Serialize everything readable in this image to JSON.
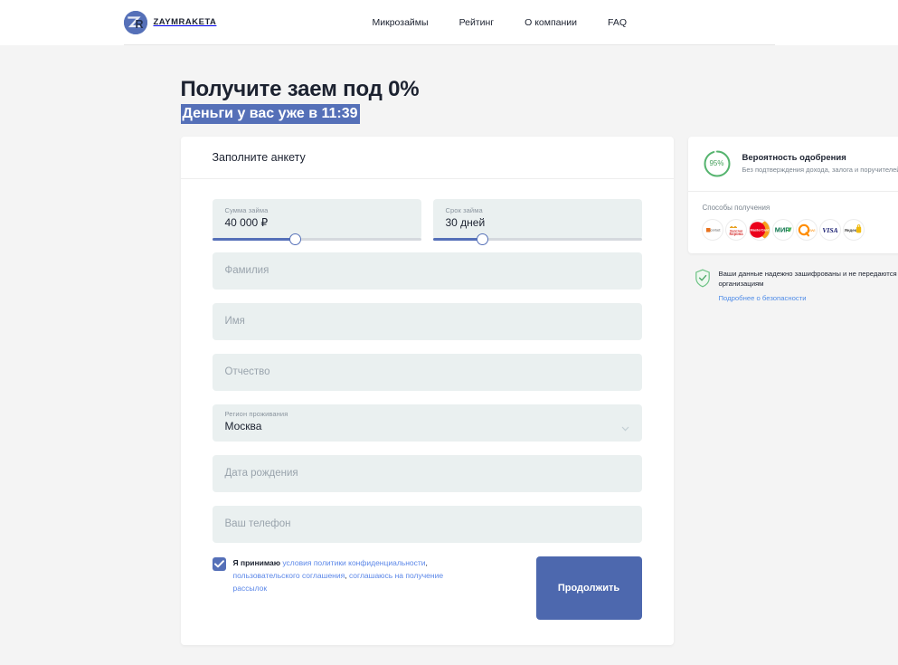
{
  "header": {
    "brand_name": "ZAYMRAKETA",
    "brand_mark_icon": "zr-monogram-logo-icon",
    "nav": [
      {
        "label": "Микрозаймы"
      },
      {
        "label": "Рейтинг"
      },
      {
        "label": "О компании"
      },
      {
        "label": "FAQ"
      }
    ]
  },
  "hero": {
    "title": "Получите заем под 0%",
    "subtitle": "Деньги у вас уже в 11:39",
    "highlight_color": "#5570b8"
  },
  "form": {
    "card_title": "Заполните анкету",
    "amount": {
      "label": "Сумма займа",
      "value": "40 000 ₽",
      "slider_percent": 40
    },
    "term": {
      "label": "Срок займа",
      "value": "30 дней",
      "slider_percent": 24
    },
    "fields": [
      {
        "name": "surname",
        "placeholder": "Фамилия",
        "value": ""
      },
      {
        "name": "firstname",
        "placeholder": "Имя",
        "value": ""
      },
      {
        "name": "patronymic",
        "placeholder": "Отчество",
        "value": ""
      }
    ],
    "region": {
      "label": "Регион проживания",
      "value": "Москва",
      "chevron_icon": "chevron-down-icon"
    },
    "fields_after": [
      {
        "name": "birthdate",
        "placeholder": "Дата рождения",
        "value": ""
      },
      {
        "name": "phone",
        "placeholder": "Ваш телефон",
        "value": ""
      }
    ],
    "consent": {
      "checked": true,
      "checkbox_icon": "checkmark-icon",
      "lead": "Я принимаю ",
      "link1": "условия политики конфиденциальности",
      "sep1": ", ",
      "link2": "пользовательского соглашения",
      "sep2": ", ",
      "link3": "соглашаюсь на получение рассылок"
    },
    "submit_label": "Продолжить",
    "submit_color": "#4d68ae"
  },
  "sidebar": {
    "approval": {
      "percent_label": "95%",
      "percent_value": 95,
      "ring_color": "#55b46e",
      "title": "Вероятность одобрения",
      "subtitle": "Без подтверждения дохода, залога и поручителей."
    },
    "payways": {
      "title": "Способы получения",
      "items": [
        {
          "name": "contact-payment-icon",
          "label": "contact"
        },
        {
          "name": "zolotaya-korona-payment-icon",
          "label": "Золотая Корона"
        },
        {
          "name": "mastercard-payment-icon",
          "label": "MasterCard"
        },
        {
          "name": "mir-payment-icon",
          "label": "МИР"
        },
        {
          "name": "qiwi-payment-icon",
          "label": "QIWI"
        },
        {
          "name": "visa-payment-icon",
          "label": "VISA"
        },
        {
          "name": "yandex-money-payment-icon",
          "label": "Яндекс.Деньги"
        }
      ]
    },
    "security": {
      "shield_icon": "shield-check-icon",
      "text": "Ваши данные надежно зашифрованы и не передаются сторонним организациям",
      "link": "Подробнее о безопасности"
    }
  }
}
